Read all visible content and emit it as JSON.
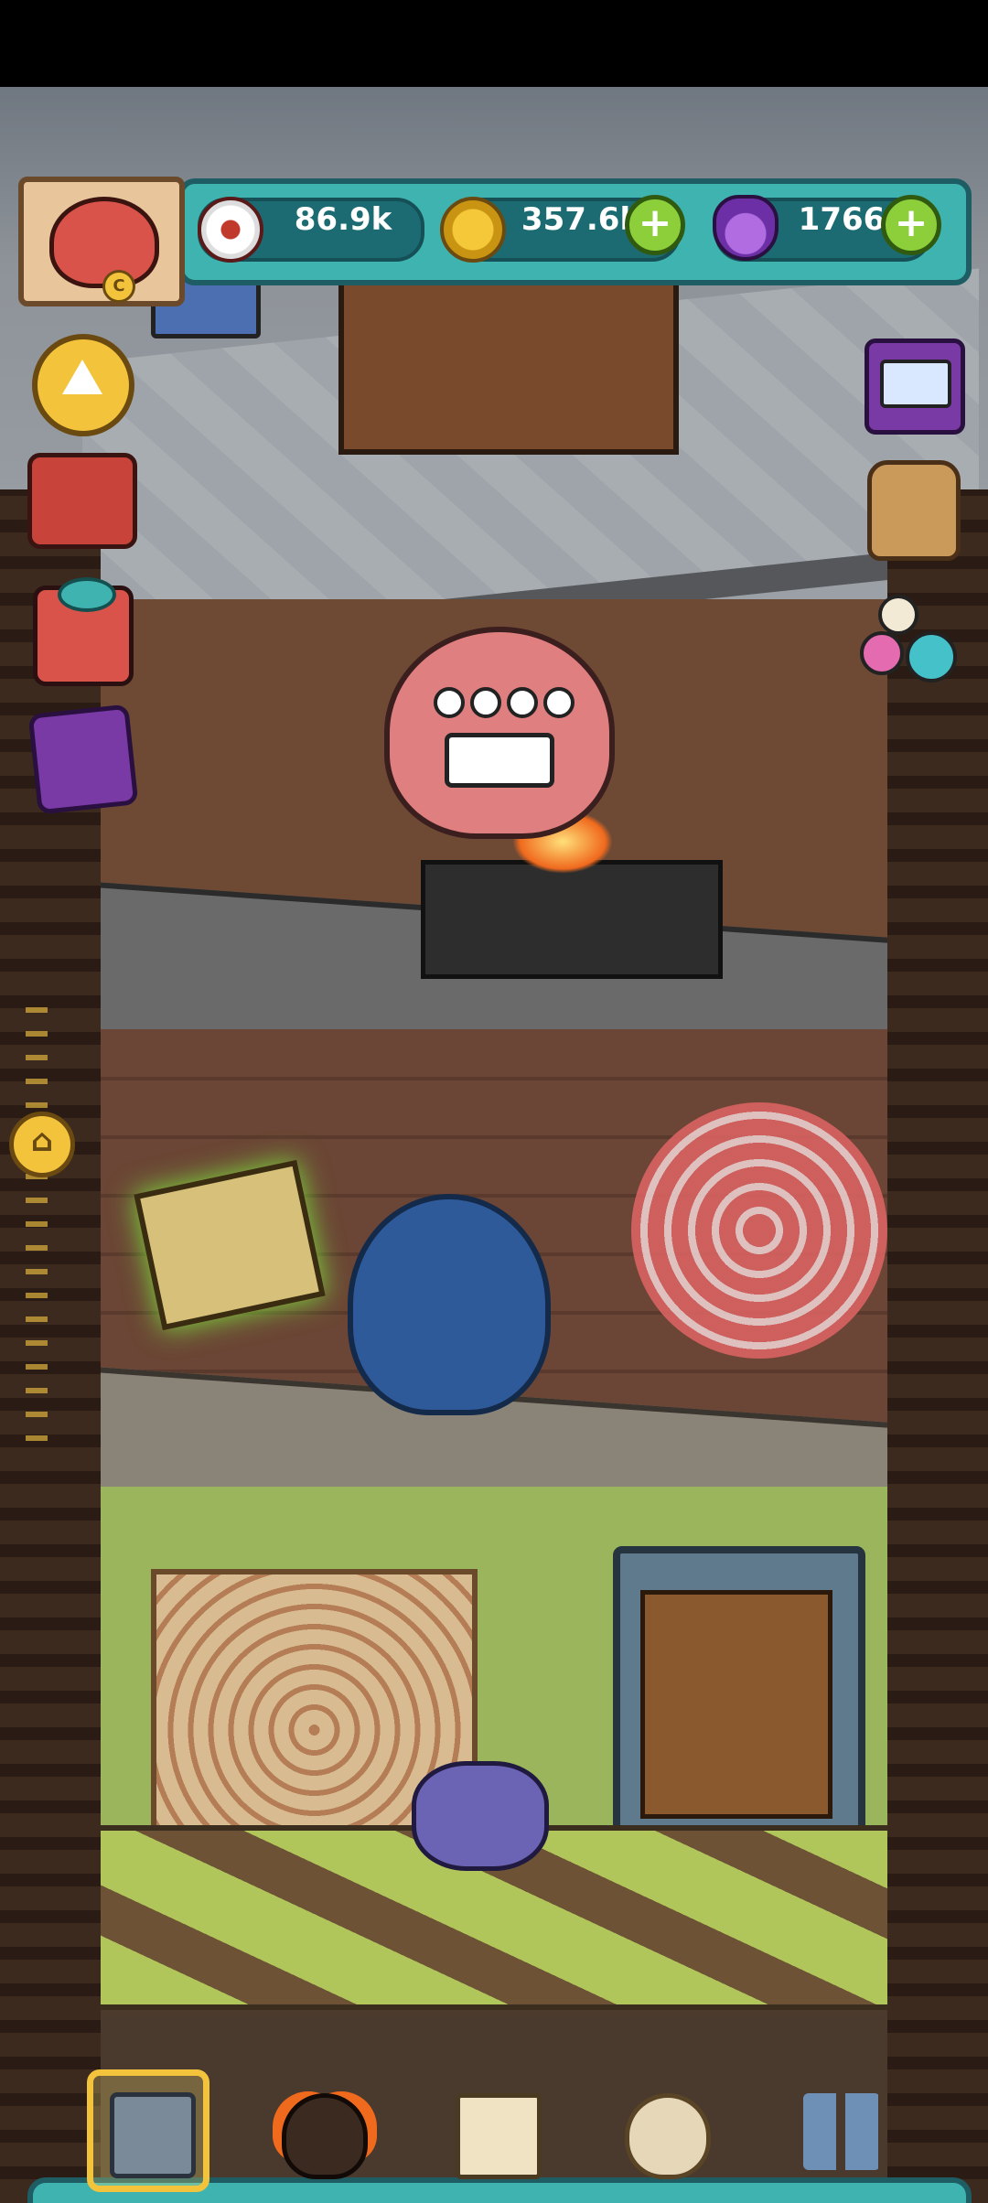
{
  "hud": {
    "eyes_value": "86.9k",
    "coins_value": "357.6k",
    "potions_value": "1766",
    "plus_symbol": "+",
    "avatar_badge": "C"
  },
  "icons": {
    "eye": "eyeball-icon",
    "coin": "coin-icon",
    "potion": "potion-icon",
    "home": "home-icon",
    "up": "up-arrow-icon"
  },
  "nav": {
    "items": [
      "building",
      "monster",
      "book",
      "sack",
      "grid-menu"
    ],
    "selected": "building"
  },
  "colors": {
    "hud_teal": "#3fb3b0",
    "plus_green": "#8ccf3a",
    "gold": "#f3c33b"
  }
}
